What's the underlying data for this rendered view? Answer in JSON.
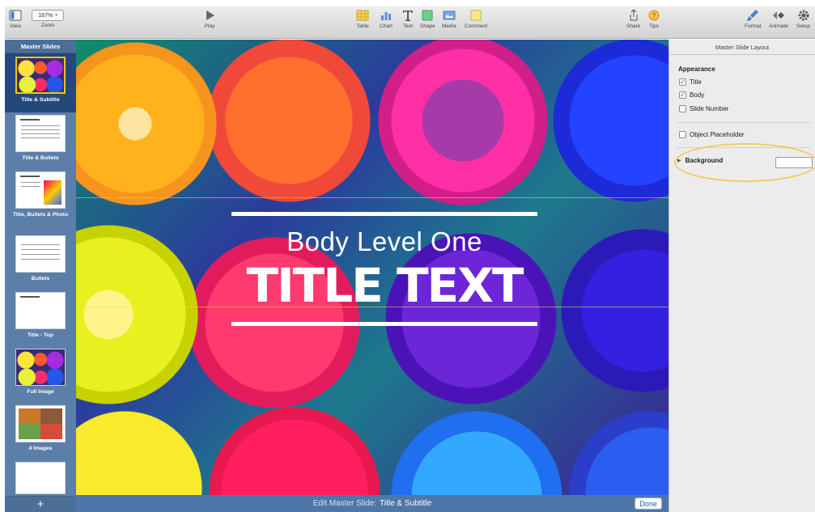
{
  "toolbar": {
    "view_label": "View",
    "zoom_label": "Zoom",
    "zoom_value": "167%",
    "play_label": "Play",
    "insert_items": [
      "Table",
      "Chart",
      "Text",
      "Shape",
      "Media",
      "Comment"
    ],
    "share_label": "Share",
    "tips_label": "Tips",
    "format_label": "Format",
    "animate_label": "Animate",
    "setup_label": "Setup"
  },
  "sidebar": {
    "header": "Master Slides",
    "items": [
      {
        "label": "Title & Subtitle",
        "selected": true
      },
      {
        "label": "Title & Bullets",
        "selected": false
      },
      {
        "label": "Title, Bullets & Photo",
        "selected": false
      },
      {
        "label": "Bullets",
        "selected": false
      },
      {
        "label": "Title - Top",
        "selected": false
      },
      {
        "label": "Full Image",
        "selected": false
      },
      {
        "label": "4 Images",
        "selected": false
      },
      {
        "label": "",
        "selected": false
      }
    ],
    "add_label": "+"
  },
  "slide": {
    "body_text": "Body Level One",
    "title_text": "TITLE TEXT"
  },
  "editbar": {
    "prefix": "Edit Master Slide:",
    "slide_name": "Title & Subtitle",
    "done_label": "Done"
  },
  "inspector": {
    "header": "Master Slide Layout",
    "appearance_label": "Appearance",
    "options": [
      {
        "label": "Title",
        "checked": true
      },
      {
        "label": "Body",
        "checked": true
      },
      {
        "label": "Slide Number",
        "checked": false
      }
    ],
    "object_placeholder": {
      "label": "Object Placeholder",
      "checked": false
    },
    "background_label": "Background"
  },
  "colors": {
    "sidebar": "#5b7fa8",
    "sidebar_selected": "#23497a",
    "highlight": "#f0cd5c",
    "checkbox_accent": "#1d5ecf"
  }
}
